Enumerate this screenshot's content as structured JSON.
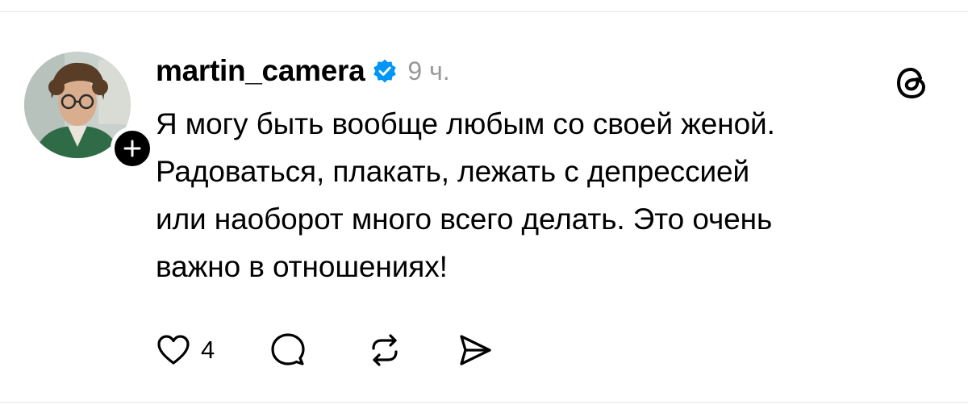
{
  "post": {
    "author": {
      "username": "martin_camera",
      "verified": true,
      "avatar_icon": "avatar-photo",
      "follow_icon": "plus-icon"
    },
    "time": "9 ч.",
    "text": "Я могу быть вообще любым со своей женой.\nРадоваться, плакать, лежать с депрессией\nили наоборот много всего делать. Это очень\nважно в отношениях!",
    "likes": "4"
  },
  "icons": {
    "platform": "threads-logo-icon",
    "like": "heart-icon",
    "comment": "comment-icon",
    "repost": "repost-icon",
    "share": "send-icon"
  },
  "colors": {
    "verified": "#0095f6",
    "meta_text": "#999999",
    "text": "#000000"
  }
}
